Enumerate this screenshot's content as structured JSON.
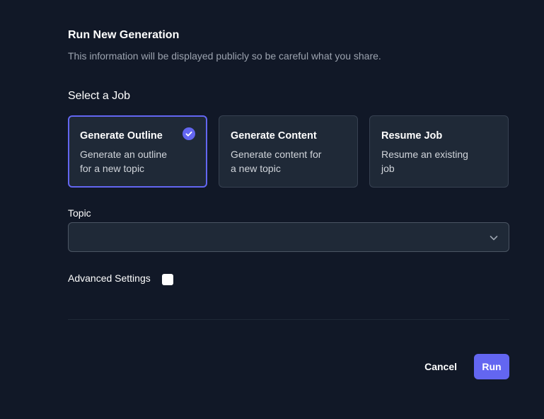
{
  "header": {
    "title": "Run New Generation",
    "subtitle": "This information will be displayed publicly so be careful what you share."
  },
  "job_section": {
    "title": "Select a Job",
    "selected_index": 0,
    "jobs": [
      {
        "title": "Generate Outline",
        "description": "Generate an outline for a new topic",
        "selected": true
      },
      {
        "title": "Generate Content",
        "description": "Generate content for a new topic",
        "selected": false
      },
      {
        "title": "Resume Job",
        "description": "Resume an existing job",
        "selected": false
      }
    ]
  },
  "topic": {
    "label": "Topic",
    "value": ""
  },
  "advanced": {
    "label": "Advanced Settings",
    "checked": false
  },
  "actions": {
    "cancel_label": "Cancel",
    "run_label": "Run"
  },
  "colors": {
    "background": "#111827",
    "card": "#1f2937",
    "accent": "#6366f1",
    "muted_text": "#9ca3af"
  },
  "icons": {
    "selected": "check-circle-icon",
    "select_arrow": "chevron-down-icon"
  }
}
